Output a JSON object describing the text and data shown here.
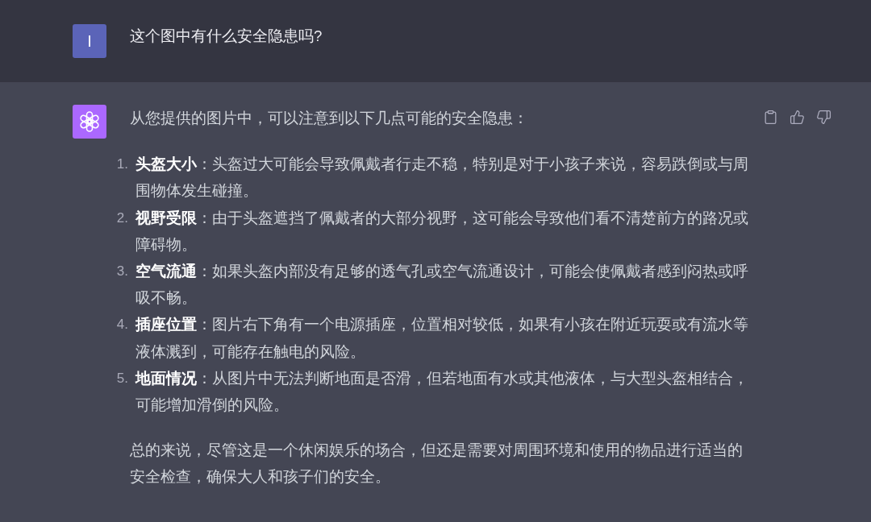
{
  "user_message": {
    "avatar_letter": "I",
    "text": "这个图中有什么安全隐患吗?"
  },
  "assistant_message": {
    "intro": "从您提供的图片中，可以注意到以下几点可能的安全隐患：",
    "items": [
      {
        "number": "1.",
        "text": "**头盔大小**：头盔过大可能会导致佩戴者行走不稳，特别是对于小孩子来说，容易跌倒或与周围物体发生碰撞。"
      },
      {
        "number": "2.",
        "text": "**视野受限**：由于头盔遮挡了佩戴者的大部分视野，这可能会导致他们看不清楚前方的路况或障碍物。"
      },
      {
        "number": "3.",
        "text": "**空气流通**：如果头盔内部没有足够的透气孔或空气流通设计，可能会使佩戴者感到闷热或呼吸不畅。"
      },
      {
        "number": "4.",
        "text": "**插座位置**：图片右下角有一个电源插座，位置相对较低，如果有小孩在附近玩耍或有流水等液体溅到，可能存在触电的风险。"
      },
      {
        "number": "5.",
        "text": "**地面情况**：从图片中无法判断地面是否滑，但若地面有水或其他液体，与大型头盔相结合，可能增加滑倒的风险。"
      }
    ],
    "conclusion": "总的来说，尽管这是一个休闲娱乐的场合，但还是需要对周围环境和使用的物品进行适当的安全检查，确保大人和孩子们的安全。"
  }
}
